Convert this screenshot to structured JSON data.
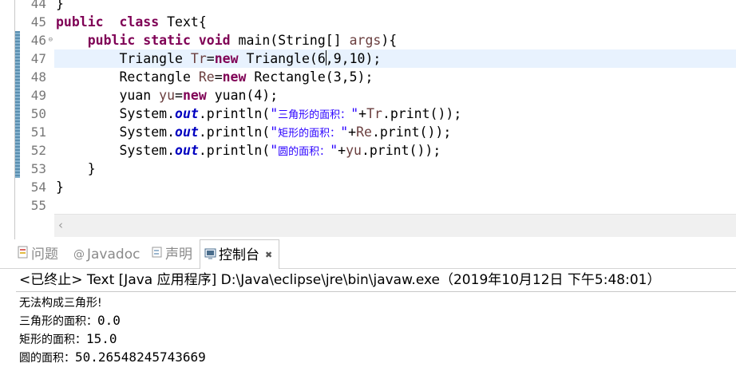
{
  "editor": {
    "line_numbers": [
      "44",
      "45",
      "46",
      "47",
      "48",
      "49",
      "50",
      "51",
      "52",
      "53",
      "54",
      "55"
    ],
    "lines": [
      [
        {
          "t": "}"
        }
      ],
      [
        {
          "t": "public",
          "c": "kw"
        },
        {
          "t": "  "
        },
        {
          "t": "class",
          "c": "kw"
        },
        {
          "t": " Text{"
        }
      ],
      [
        {
          "t": "    "
        },
        {
          "t": "public",
          "c": "kw"
        },
        {
          "t": " "
        },
        {
          "t": "static",
          "c": "kw"
        },
        {
          "t": " "
        },
        {
          "t": "void",
          "c": "kw"
        },
        {
          "t": " main(String[] "
        },
        {
          "t": "args",
          "c": "var"
        },
        {
          "t": "){"
        }
      ],
      [
        {
          "t": "        Triangle "
        },
        {
          "t": "Tr",
          "c": "var"
        },
        {
          "t": "="
        },
        {
          "t": "new",
          "c": "kw"
        },
        {
          "t": " Triangle(6"
        },
        {
          "caret": true
        },
        {
          "t": ",9,10);"
        }
      ],
      [
        {
          "t": "        Rectangle "
        },
        {
          "t": "Re",
          "c": "var"
        },
        {
          "t": "="
        },
        {
          "t": "new",
          "c": "kw"
        },
        {
          "t": " Rectangle(3,5);"
        }
      ],
      [
        {
          "t": "        yuan "
        },
        {
          "t": "yu",
          "c": "var"
        },
        {
          "t": "="
        },
        {
          "t": "new",
          "c": "kw"
        },
        {
          "t": " yuan(4);"
        }
      ],
      [
        {
          "t": "        System."
        },
        {
          "t": "out",
          "c": "fld"
        },
        {
          "t": ".println("
        },
        {
          "t": "\"",
          "c": "str"
        },
        {
          "t": "三角形的面积：",
          "c": "str cn"
        },
        {
          "t": "\"",
          "c": "str"
        },
        {
          "t": "+"
        },
        {
          "t": "Tr",
          "c": "var"
        },
        {
          "t": ".print());"
        }
      ],
      [
        {
          "t": "        System."
        },
        {
          "t": "out",
          "c": "fld"
        },
        {
          "t": ".println("
        },
        {
          "t": "\"",
          "c": "str"
        },
        {
          "t": "矩形的面积：",
          "c": "str cn"
        },
        {
          "t": "\"",
          "c": "str"
        },
        {
          "t": "+"
        },
        {
          "t": "Re",
          "c": "var"
        },
        {
          "t": ".print());"
        }
      ],
      [
        {
          "t": "        System."
        },
        {
          "t": "out",
          "c": "fld"
        },
        {
          "t": ".println("
        },
        {
          "t": "\"",
          "c": "str"
        },
        {
          "t": "圆的面积：",
          "c": "str cn"
        },
        {
          "t": "\"",
          "c": "str"
        },
        {
          "t": "+"
        },
        {
          "t": "yu",
          "c": "var"
        },
        {
          "t": ".print());"
        }
      ],
      [
        {
          "t": "    }"
        }
      ],
      [
        {
          "t": "}"
        }
      ],
      [
        {
          "t": ""
        }
      ]
    ],
    "current_line_index": 3
  },
  "tabs": [
    {
      "label": "问题",
      "icon": "problems-icon",
      "active": false
    },
    {
      "label": "Javadoc",
      "icon": "javadoc-icon",
      "active": false
    },
    {
      "label": "声明",
      "icon": "declaration-icon",
      "active": false
    },
    {
      "label": "控制台",
      "icon": "console-icon",
      "active": true
    }
  ],
  "console": {
    "status": "<已终止> Text [Java 应用程序] D:\\Java\\eclipse\\jre\\bin\\javaw.exe（2019年10月12日 下午5:48:01）",
    "output": [
      [
        {
          "t": "无法构成三角形!",
          "c": "cn"
        }
      ],
      [
        {
          "t": "三角形的面积：",
          "c": "cn"
        },
        {
          "t": "0.0"
        }
      ],
      [
        {
          "t": "矩形的面积：",
          "c": "cn"
        },
        {
          "t": "15.0"
        }
      ],
      [
        {
          "t": "圆的面积：",
          "c": "cn"
        },
        {
          "t": "50.26548245743669"
        }
      ]
    ]
  },
  "colors": {
    "keyword": "#7f0055",
    "string": "#2a00ff",
    "static_field": "#0000c0",
    "current_line_highlight": "#e8f2fe"
  }
}
